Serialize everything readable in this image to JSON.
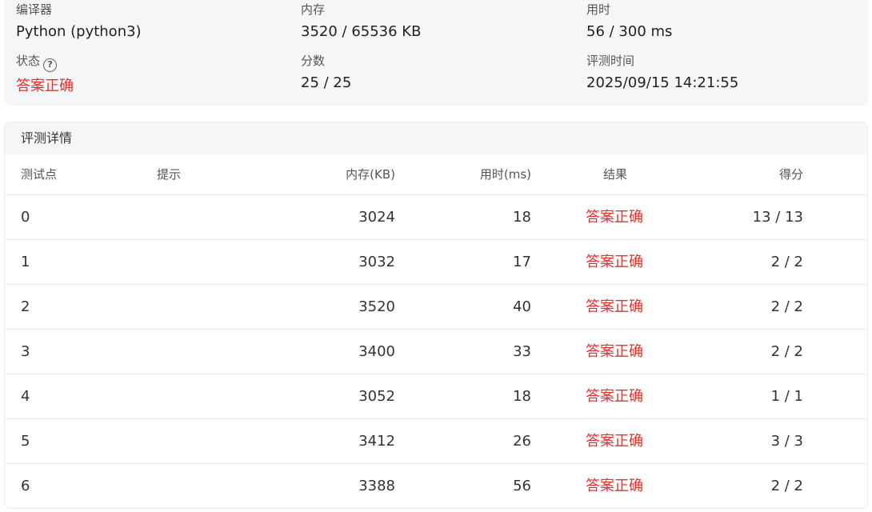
{
  "summary": {
    "compiler_label": "编译器",
    "compiler_value": "Python (python3)",
    "memory_label": "内存",
    "memory_value": "3520 / 65536 KB",
    "time_label": "用时",
    "time_value": "56 / 300 ms",
    "status_label": "状态",
    "status_help": "?",
    "status_value": "答案正确",
    "score_label": "分数",
    "score_value": "25 / 25",
    "judge_time_label": "评测时间",
    "judge_time_value": "2025/09/15 14:21:55"
  },
  "details": {
    "title": "评测详情",
    "headers": {
      "point": "测试点",
      "hint": "提示",
      "memory": "内存(KB)",
      "time": "用时(ms)",
      "result": "结果",
      "score": "得分"
    },
    "rows": [
      {
        "point": "0",
        "hint": "",
        "memory": "3024",
        "time": "18",
        "result": "答案正确",
        "score": "13 / 13"
      },
      {
        "point": "1",
        "hint": "",
        "memory": "3032",
        "time": "17",
        "result": "答案正确",
        "score": "2 / 2"
      },
      {
        "point": "2",
        "hint": "",
        "memory": "3520",
        "time": "40",
        "result": "答案正确",
        "score": "2 / 2"
      },
      {
        "point": "3",
        "hint": "",
        "memory": "3400",
        "time": "33",
        "result": "答案正确",
        "score": "2 / 2"
      },
      {
        "point": "4",
        "hint": "",
        "memory": "3052",
        "time": "18",
        "result": "答案正确",
        "score": "1 / 1"
      },
      {
        "point": "5",
        "hint": "",
        "memory": "3412",
        "time": "26",
        "result": "答案正确",
        "score": "3 / 3"
      },
      {
        "point": "6",
        "hint": "",
        "memory": "3388",
        "time": "56",
        "result": "答案正确",
        "score": "2 / 2"
      }
    ]
  },
  "colors": {
    "accepted": "#e5302a",
    "panel_bg": "#f5f6f8"
  }
}
